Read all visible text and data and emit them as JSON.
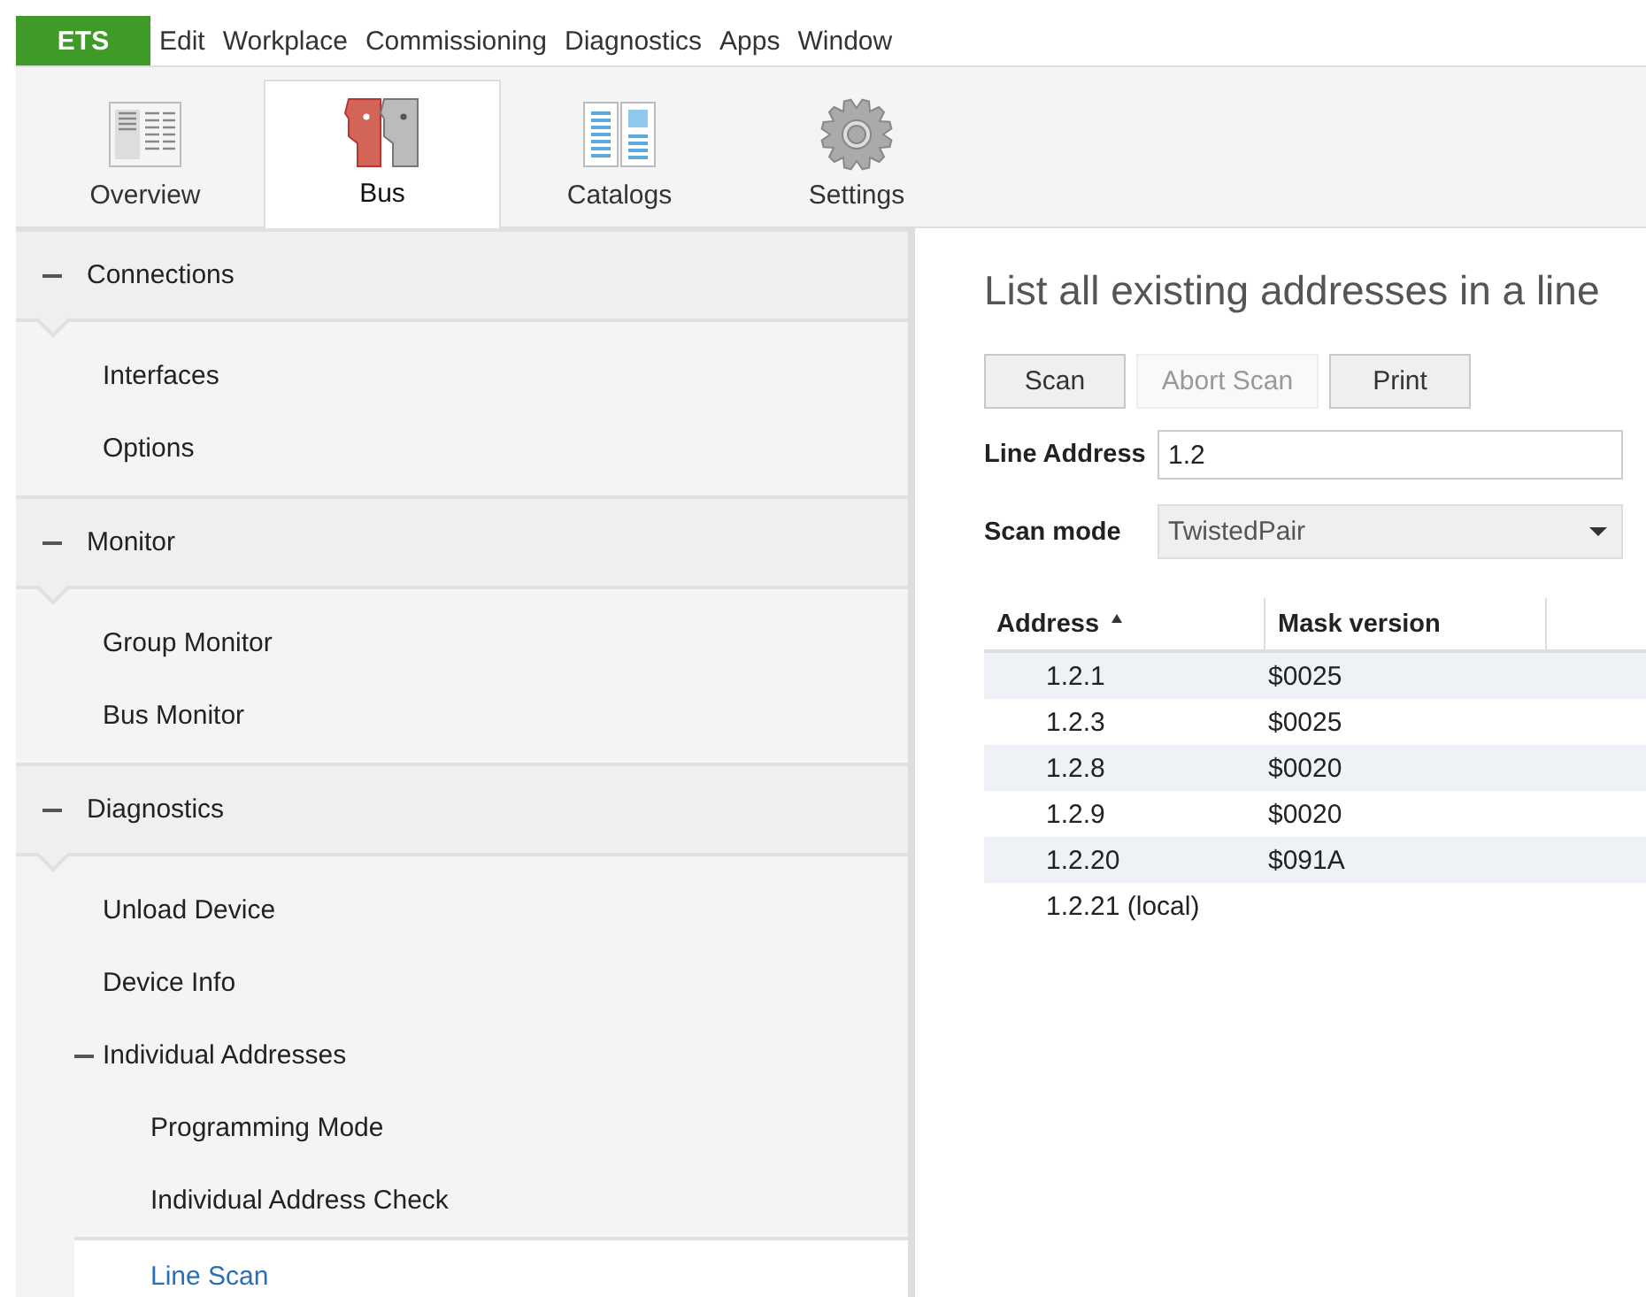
{
  "menu": [
    {
      "label": "ETS",
      "kind": "brand"
    },
    {
      "label": "Edit",
      "kind": "item"
    },
    {
      "label": "Workplace",
      "kind": "item"
    },
    {
      "label": "Commissioning",
      "kind": "item"
    },
    {
      "label": "Diagnostics",
      "kind": "item"
    },
    {
      "label": "Apps",
      "kind": "item"
    },
    {
      "label": "Window",
      "kind": "item"
    }
  ],
  "tabs": [
    {
      "label": "Overview",
      "selected": false
    },
    {
      "label": "Bus",
      "selected": true
    },
    {
      "label": "Catalogs",
      "selected": false
    },
    {
      "label": "Settings",
      "selected": false
    }
  ],
  "sidebar": {
    "sections": [
      {
        "label": "Connections",
        "expanded": true,
        "items": [
          {
            "label": "Interfaces",
            "selected": false
          },
          {
            "label": "Options",
            "selected": false
          }
        ]
      },
      {
        "label": "Monitor",
        "expanded": true,
        "items": [
          {
            "label": "Group Monitor",
            "selected": false
          },
          {
            "label": "Bus Monitor",
            "selected": false
          }
        ]
      },
      {
        "label": "Diagnostics",
        "expanded": true,
        "items": [
          {
            "label": "Unload Device",
            "selected": false
          },
          {
            "label": "Device Info",
            "selected": false
          },
          {
            "label": "Individual Addresses",
            "selected": false,
            "expanded": true,
            "children": [
              {
                "label": "Programming Mode",
                "selected": false
              },
              {
                "label": "Individual Address Check",
                "selected": false
              },
              {
                "label": "Line Scan",
                "selected": true
              }
            ]
          }
        ]
      }
    ]
  },
  "panel": {
    "title": "List all existing addresses in a line",
    "buttons": [
      {
        "label": "Scan",
        "disabled": false
      },
      {
        "label": "Abort Scan",
        "disabled": true
      },
      {
        "label": "Print",
        "disabled": false
      }
    ],
    "line_address": {
      "label": "Line Address",
      "value": "1.2"
    },
    "scan_mode": {
      "label": "Scan mode",
      "value": "TwistedPair"
    },
    "table": {
      "columns": [
        {
          "label": "Address",
          "sorted": true
        },
        {
          "label": "Mask version",
          "sorted": false
        }
      ],
      "rows": [
        {
          "address": "1.2.1",
          "mask_version": "$0025"
        },
        {
          "address": "1.2.3",
          "mask_version": "$0025"
        },
        {
          "address": "1.2.8",
          "mask_version": "$0020"
        },
        {
          "address": "1.2.9",
          "mask_version": "$0020"
        },
        {
          "address": "1.2.20",
          "mask_version": "$091A"
        },
        {
          "address": "1.2.21 (local)"
        }
      ]
    }
  }
}
